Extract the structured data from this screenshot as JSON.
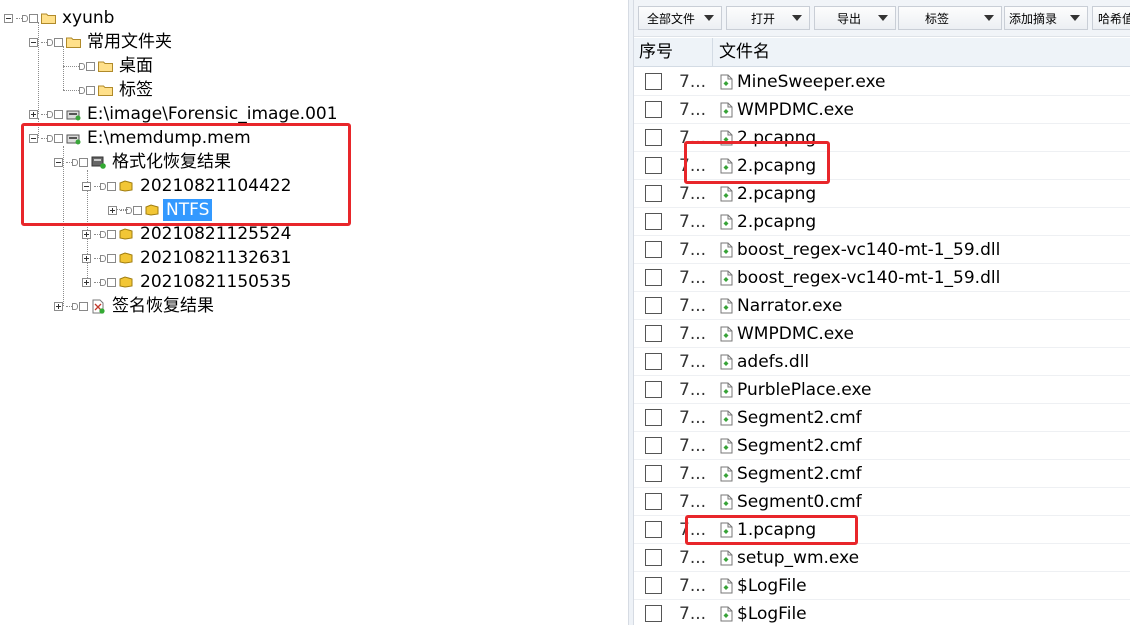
{
  "tree": {
    "nodes": [
      {
        "label": "xyunb",
        "icon": "folder-icon"
      },
      {
        "label": "常用文件夹",
        "icon": "folder-icon"
      },
      {
        "label": "桌面",
        "icon": "folder-icon"
      },
      {
        "label": "标签",
        "icon": "folder-icon"
      },
      {
        "label": "E:\\image\\Forensic_image.001",
        "icon": "disk-image-icon"
      },
      {
        "label": "E:\\memdump.mem",
        "icon": "disk-image-icon"
      },
      {
        "label": "格式化恢复结果",
        "icon": "recovery-icon"
      },
      {
        "label": "20210821104422",
        "icon": "partition-folder-icon"
      },
      {
        "label": "NTFS",
        "icon": "partition-folder-icon"
      },
      {
        "label": "20210821125524",
        "icon": "partition-folder-icon"
      },
      {
        "label": "20210821132631",
        "icon": "partition-folder-icon"
      },
      {
        "label": "20210821150535",
        "icon": "partition-folder-icon"
      },
      {
        "label": "签名恢复结果",
        "icon": "signature-recovery-icon"
      }
    ]
  },
  "toolbar": {
    "all_files": "全部文件",
    "open": "打开",
    "export": "导出",
    "bookmark": "标签",
    "add_digest": "添加摘录",
    "hash": "哈希值"
  },
  "list": {
    "header_seq": "序号",
    "header_name": "文件名",
    "rows": [
      {
        "seq": "7...",
        "name": "MineSweeper.exe"
      },
      {
        "seq": "7...",
        "name": "WMPDMC.exe"
      },
      {
        "seq": "7...",
        "name": "2.pcapng"
      },
      {
        "seq": "7...",
        "name": "2.pcapng"
      },
      {
        "seq": "7...",
        "name": "2.pcapng"
      },
      {
        "seq": "7...",
        "name": "2.pcapng"
      },
      {
        "seq": "7...",
        "name": "boost_regex-vc140-mt-1_59.dll"
      },
      {
        "seq": "7...",
        "name": "boost_regex-vc140-mt-1_59.dll"
      },
      {
        "seq": "7...",
        "name": "Narrator.exe"
      },
      {
        "seq": "7...",
        "name": "WMPDMC.exe"
      },
      {
        "seq": "7...",
        "name": "adefs.dll"
      },
      {
        "seq": "7...",
        "name": "PurblePlace.exe"
      },
      {
        "seq": "7...",
        "name": "Segment2.cmf"
      },
      {
        "seq": "7...",
        "name": "Segment2.cmf"
      },
      {
        "seq": "7...",
        "name": "Segment2.cmf"
      },
      {
        "seq": "7...",
        "name": "Segment0.cmf"
      },
      {
        "seq": "7...",
        "name": "1.pcapng"
      },
      {
        "seq": "7...",
        "name": "setup_wm.exe"
      },
      {
        "seq": "7...",
        "name": "$LogFile"
      },
      {
        "seq": "7...",
        "name": "$LogFile"
      }
    ]
  },
  "colors": {
    "selection": "#3399ff",
    "annotation": "#e8262a"
  }
}
